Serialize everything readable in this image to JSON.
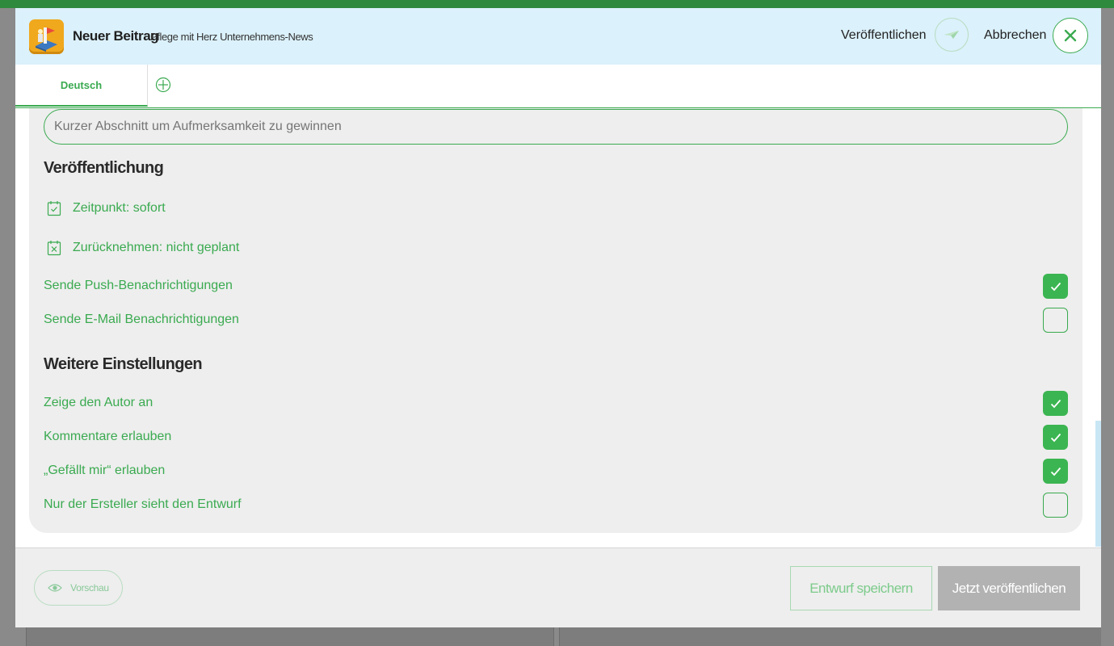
{
  "header": {
    "title": "Neuer Beitrag",
    "subtitle": "Pflege mit Herz Unternehmens-News",
    "publish_label": "Veröffentlichen",
    "cancel_label": "Abbrechen"
  },
  "tabs": [
    {
      "label": "Deutsch",
      "active": true
    }
  ],
  "teaser": {
    "placeholder": "Kurzer Abschnitt um Aufmerksamkeit zu gewinnen",
    "value": ""
  },
  "publication": {
    "title": "Veröffentlichung",
    "time_label": "Zeitpunkt: sofort",
    "revoke_label": "Zurücknehmen: nicht geplant",
    "options": [
      {
        "label": "Sende Push-Benachrichtigungen",
        "checked": true
      },
      {
        "label": "Sende E-Mail Benachrichtigungen",
        "checked": false
      }
    ]
  },
  "more_settings": {
    "title": "Weitere Einstellungen",
    "options": [
      {
        "label": "Zeige den Autor an",
        "checked": true
      },
      {
        "label": "Kommentare erlauben",
        "checked": true
      },
      {
        "label": "„Gefällt mir“ erlauben",
        "checked": true
      },
      {
        "label": "Nur der Ersteller sieht den Entwurf",
        "checked": false
      }
    ]
  },
  "footer": {
    "preview_label": "Vorschau",
    "save_draft_label": "Entwurf speichern",
    "publish_now_label": "Jetzt veröffentlichen"
  },
  "colors": {
    "accent": "#3aaa50",
    "header_bg": "#dbf1fb",
    "panel_bg": "#eeeeee"
  }
}
